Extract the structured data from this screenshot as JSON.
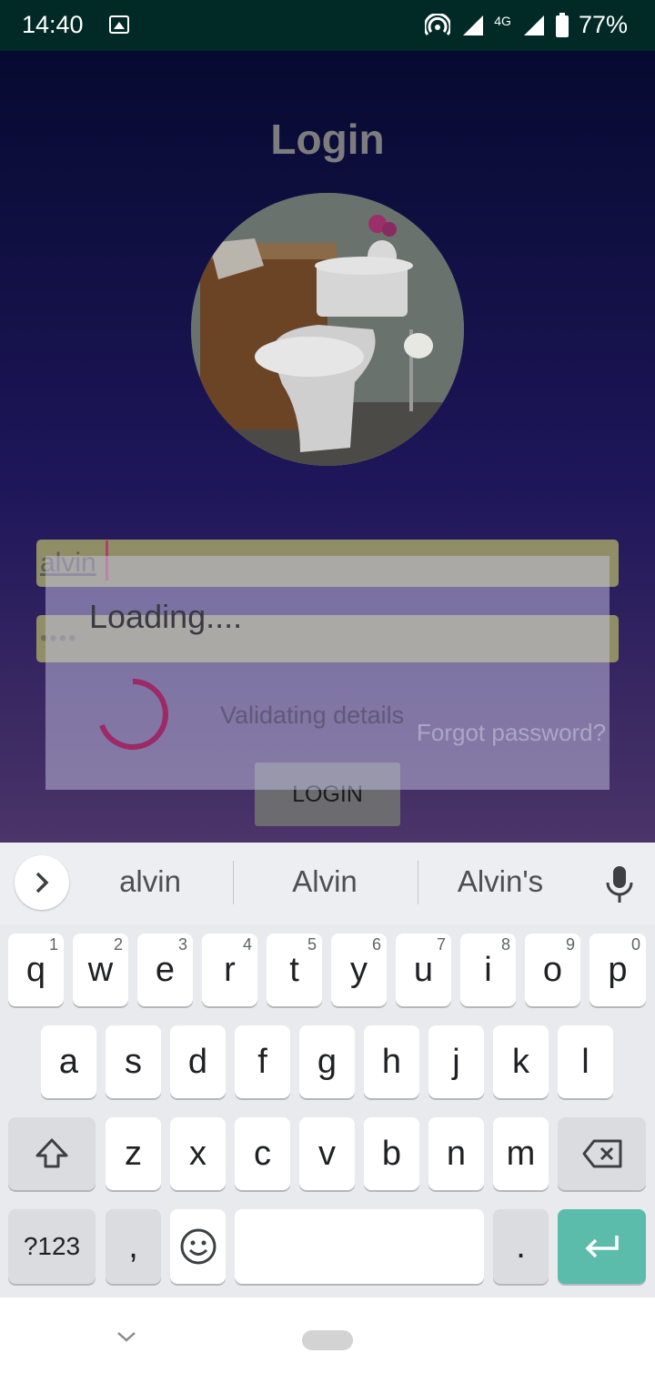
{
  "status_bar": {
    "time": "14:40",
    "signal_text": "4G",
    "battery": "77%",
    "icons": [
      "image-icon",
      "hotspot-icon",
      "signal-icon",
      "battery-icon"
    ]
  },
  "login": {
    "title": "Login",
    "username_value": "alvin",
    "password_value": "••••",
    "forgot_label": "Forgot password?",
    "login_button": "LOGIN"
  },
  "dialog": {
    "title": "Loading....",
    "message": "Validating details",
    "spinner_color": "#9b2a66"
  },
  "keyboard": {
    "suggestions": [
      "alvin",
      "Alvin",
      "Alvin's"
    ],
    "row1": [
      {
        "key": "q",
        "hint": "1"
      },
      {
        "key": "w",
        "hint": "2"
      },
      {
        "key": "e",
        "hint": "3"
      },
      {
        "key": "r",
        "hint": "4"
      },
      {
        "key": "t",
        "hint": "5"
      },
      {
        "key": "y",
        "hint": "6"
      },
      {
        "key": "u",
        "hint": "7"
      },
      {
        "key": "i",
        "hint": "8"
      },
      {
        "key": "o",
        "hint": "9"
      },
      {
        "key": "p",
        "hint": "0"
      }
    ],
    "row2": [
      "a",
      "s",
      "d",
      "f",
      "g",
      "h",
      "j",
      "k",
      "l"
    ],
    "row3": [
      "z",
      "x",
      "c",
      "v",
      "b",
      "n",
      "m"
    ],
    "symbols_key": "?123",
    "comma_key": ",",
    "period_key": ".",
    "enter_color": "#5bbcab"
  }
}
